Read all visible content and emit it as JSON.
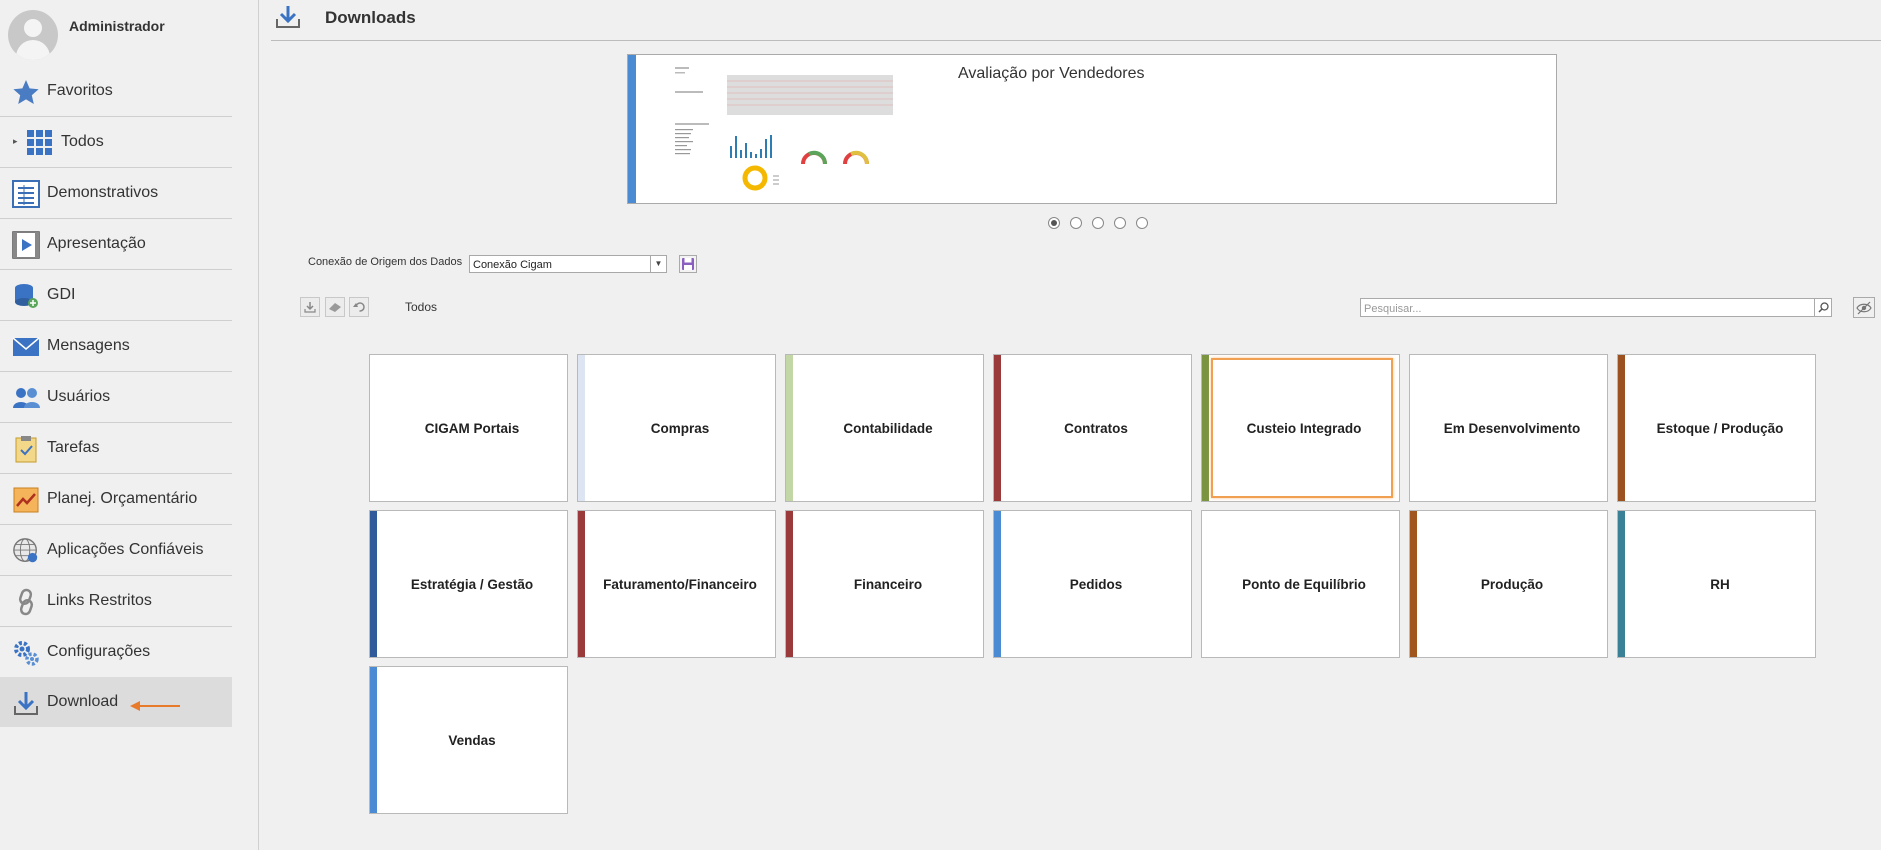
{
  "user": {
    "name": "Administrador"
  },
  "sidebar": {
    "items": [
      {
        "label": "Favoritos",
        "icon": "star-icon"
      },
      {
        "label": "Todos",
        "icon": "grid-icon"
      },
      {
        "label": "Demonstrativos",
        "icon": "report-icon"
      },
      {
        "label": "Apresentação",
        "icon": "presentation-icon"
      },
      {
        "label": "GDI",
        "icon": "database-icon"
      },
      {
        "label": "Mensagens",
        "icon": "envelope-icon"
      },
      {
        "label": "Usuários",
        "icon": "users-icon"
      },
      {
        "label": "Tarefas",
        "icon": "clipboard-icon"
      },
      {
        "label": "Planej. Orçamentário",
        "icon": "chart-icon"
      },
      {
        "label": "Aplicações Confiáveis",
        "icon": "globe-icon"
      },
      {
        "label": "Links Restritos",
        "icon": "link-icon"
      },
      {
        "label": "Configurações",
        "icon": "gears-icon"
      },
      {
        "label": "Download",
        "icon": "download-icon"
      }
    ],
    "active": "Download"
  },
  "header": {
    "title": "Downloads"
  },
  "carousel": {
    "title": "Avaliação por Vendedores",
    "dots": 5,
    "active_dot": 1
  },
  "connection": {
    "label": "Conexão de Origem dos Dados",
    "value": "Conexão Cigam"
  },
  "toolbar": {
    "filter_label": "Todos",
    "search_placeholder": "Pesquisar..."
  },
  "tiles": [
    {
      "label": "CIGAM Portais",
      "color": "#ffffff"
    },
    {
      "label": "Compras",
      "color": "#dde5f2"
    },
    {
      "label": "Contabilidade",
      "color": "#c2d6a6"
    },
    {
      "label": "Contratos",
      "color": "#9b3a3a"
    },
    {
      "label": "Custeio Integrado",
      "color": "#7b9440"
    },
    {
      "label": "Em Desenvolvimento",
      "color": "#ffffff"
    },
    {
      "label": "Estoque / Produção",
      "color": "#9c5220"
    },
    {
      "label": "Estratégia / Gestão",
      "color": "#2f5b9a"
    },
    {
      "label": "Faturamento/Financeiro",
      "color": "#9b3a3a"
    },
    {
      "label": "Financeiro",
      "color": "#9b3a3a"
    },
    {
      "label": "Pedidos",
      "color": "#4a8bd4"
    },
    {
      "label": "Ponto de Equilíbrio",
      "color": "#ffffff"
    },
    {
      "label": "Produção",
      "color": "#a0561c"
    },
    {
      "label": "RH",
      "color": "#3a8096"
    },
    {
      "label": "Vendas",
      "color": "#4a8bd4"
    }
  ],
  "selected_tile": "Custeio Integrado"
}
